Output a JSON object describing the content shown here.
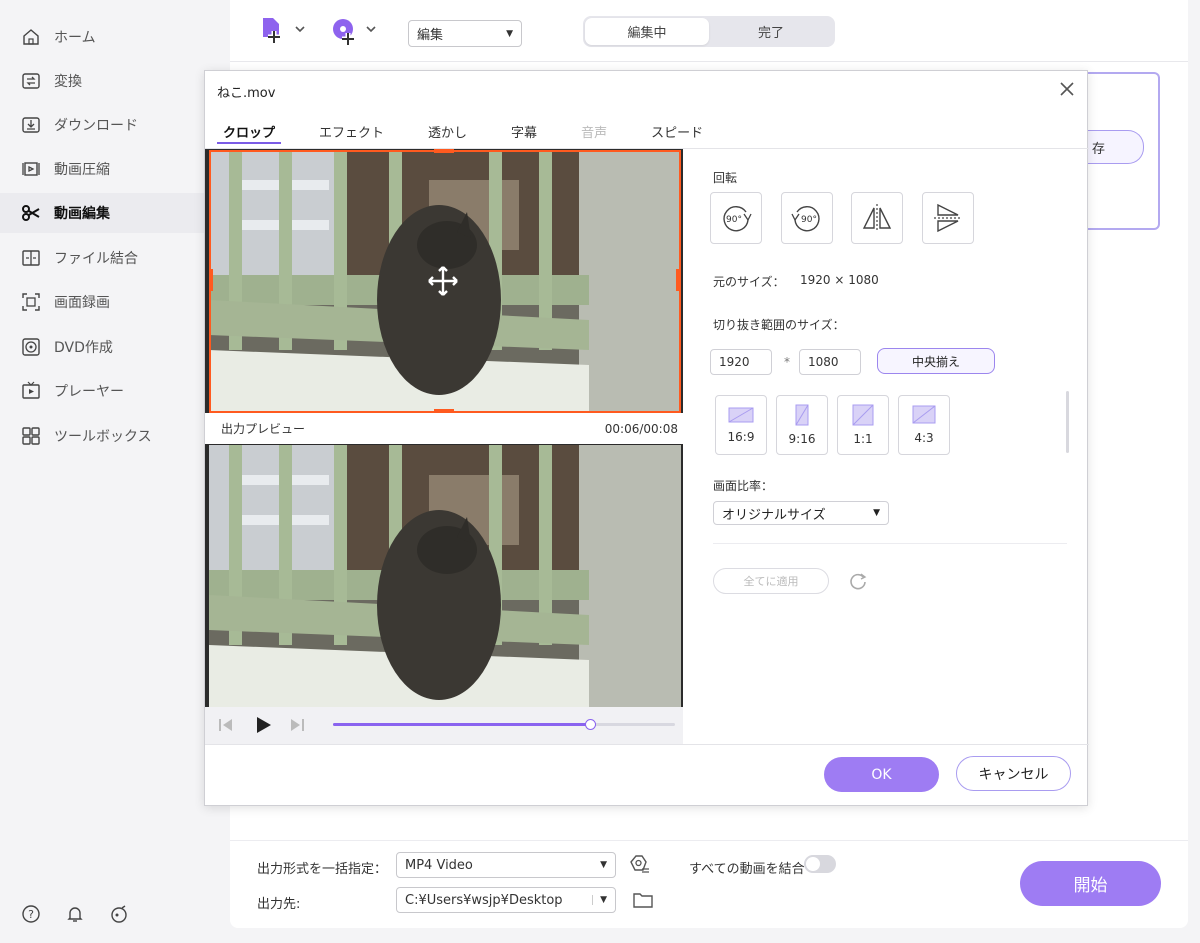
{
  "sidebar": {
    "items": [
      {
        "label": "ホーム",
        "icon": "home-icon"
      },
      {
        "label": "変換",
        "icon": "convert-icon"
      },
      {
        "label": "ダウンロード",
        "icon": "download-icon"
      },
      {
        "label": "動画圧縮",
        "icon": "compress-icon"
      },
      {
        "label": "動画編集",
        "icon": "scissors-icon",
        "active": true
      },
      {
        "label": "ファイル結合",
        "icon": "merge-icon"
      },
      {
        "label": "画面録画",
        "icon": "screen-record-icon"
      },
      {
        "label": "DVD作成",
        "icon": "dvd-icon"
      },
      {
        "label": "プレーヤー",
        "icon": "player-icon"
      },
      {
        "label": "ツールボックス",
        "icon": "toolbox-icon"
      }
    ],
    "bottom_icons": [
      "help-icon",
      "bell-icon",
      "feedback-icon"
    ]
  },
  "topbar": {
    "mode_select": "編集",
    "segments": [
      "編集中",
      "完了"
    ],
    "active_segment": "編集中"
  },
  "background_card": {
    "button_label_partial": "存"
  },
  "bottombar": {
    "format_label": "出力形式を一括指定：",
    "format_value": "MP4 Video",
    "merge_label": "すべての動画を結合",
    "merge_enabled": false,
    "output_label": "出力先:",
    "output_path": "C:¥Users¥wsjp¥Desktop",
    "start_label": "開始"
  },
  "dialog": {
    "title": "ねこ.mov",
    "tabs": [
      {
        "label": "クロップ",
        "state": "active"
      },
      {
        "label": "エフェクト",
        "state": "normal"
      },
      {
        "label": "透かし",
        "state": "normal"
      },
      {
        "label": "字幕",
        "state": "normal"
      },
      {
        "label": "音声",
        "state": "disabled"
      },
      {
        "label": "スピード",
        "state": "normal"
      }
    ],
    "preview_label": "出力プレビュー",
    "time": "00:06/00:08",
    "progress": 0.75,
    "rotate_label": "回転",
    "rotate_buttons": [
      "90°",
      "90°"
    ],
    "original_size_label": "元のサイズ：",
    "original_size_value": "1920 × 1080",
    "crop_size_label": "切り抜き範囲のサイズ：",
    "crop_width": "1920",
    "crop_sep": "*",
    "crop_height": "1080",
    "center_button": "中央揃え",
    "ratios": [
      "16:9",
      "9:16",
      "1:1",
      "4:3"
    ],
    "aspect_label": "画面比率：",
    "aspect_value": "オリジナルサイズ",
    "apply_all": "全てに適用",
    "ok": "OK",
    "cancel": "キャンセル"
  },
  "colors": {
    "accent": "#9e7cf3",
    "crop_border": "#ff5a1f"
  }
}
